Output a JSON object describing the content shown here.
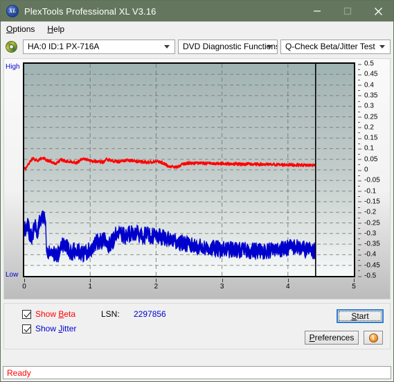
{
  "window": {
    "title": "PlexTools Professional XL V3.16",
    "icon": "app-xl-icon",
    "icon_text": "XL",
    "minimize": "minimize-icon",
    "maximize": "maximize-icon",
    "close": "close-icon",
    "titlebar_color": "#64775e"
  },
  "menubar": {
    "items": [
      {
        "label_pre": "",
        "accel": "O",
        "label_post": "ptions"
      },
      {
        "label_pre": "",
        "accel": "H",
        "label_post": "elp"
      }
    ]
  },
  "toolbar": {
    "drive_icon": "disc-icon",
    "drive": "HA:0 ID:1  PX-716A",
    "function": "DVD Diagnostic Functions",
    "test": "Q-Check Beta/Jitter Test"
  },
  "chart_labels": {
    "high": "High",
    "low": "Low"
  },
  "controls": {
    "show_beta": {
      "label_pre": "Show ",
      "accel": "B",
      "label_post": "eta",
      "checked": true,
      "color": "#ff0000"
    },
    "show_jitter": {
      "label_pre": "Show ",
      "accel": "J",
      "label_post": "itter",
      "checked": true,
      "color": "#0000cc"
    },
    "lsn_label": "LSN:",
    "lsn_value": "2297856",
    "start": {
      "label_pre": "",
      "accel": "S",
      "label_post": "tart"
    },
    "preferences": {
      "label_pre": "",
      "accel": "P",
      "label_post": "references"
    },
    "info": {
      "icon": "info-icon",
      "glyph": "i"
    }
  },
  "statusbar": {
    "text": "Ready",
    "color": "#ff0000"
  },
  "chart_data": {
    "type": "line",
    "title": "Q-Check Beta/Jitter Test",
    "xlabel": "",
    "ylabel": "",
    "xlim": [
      0,
      5
    ],
    "ylim": [
      -0.5,
      0.5
    ],
    "grid": true,
    "legend": "checkbox-toggles",
    "x_ticks": [
      0,
      1,
      2,
      3,
      4,
      5
    ],
    "x_tick_labels": [
      "0",
      "1",
      "2",
      "3",
      "4",
      "5"
    ],
    "y_ticks": [
      0.5,
      0.45,
      0.4,
      0.35,
      0.3,
      0.25,
      0.2,
      0.15,
      0.1,
      0.05,
      0,
      -0.05,
      -0.1,
      -0.15,
      -0.2,
      -0.25,
      -0.3,
      -0.35,
      -0.4,
      -0.45,
      -0.5
    ],
    "y_tick_labels": [
      "0.5",
      "0.45",
      "0.4",
      "0.35",
      "0.3",
      "0.25",
      "0.2",
      "0.15",
      "0.1",
      "0.05",
      "0",
      "-0.05",
      "-0.1",
      "-0.15",
      "-0.2",
      "-0.25",
      "-0.3",
      "-0.35",
      "-0.4",
      "-0.45",
      "-0.5"
    ],
    "gridlines_major_x": [
      1,
      2,
      3,
      4
    ],
    "data_end_x": 4.42,
    "axis_label_top": "High",
    "axis_label_bottom": "Low",
    "series": [
      {
        "name": "Beta",
        "color": "#ff0000",
        "x": [
          0.02,
          0.05,
          0.08,
          0.11,
          0.14,
          0.17,
          0.2,
          0.24,
          0.28,
          0.32,
          0.36,
          0.4,
          0.44,
          0.48,
          0.52,
          0.56,
          0.6,
          0.65,
          0.7,
          0.75,
          0.8,
          0.85,
          0.9,
          0.95,
          1.0,
          1.05,
          1.1,
          1.15,
          1.2,
          1.25,
          1.3,
          1.35,
          1.4,
          1.45,
          1.5,
          1.55,
          1.6,
          1.65,
          1.7,
          1.8,
          1.9,
          2.0,
          2.1,
          2.2,
          2.3,
          2.4,
          2.5,
          2.6,
          2.7,
          2.8,
          2.9,
          3.0,
          3.1,
          3.2,
          3.3,
          3.4,
          3.5,
          3.6,
          3.7,
          3.8,
          3.9,
          4.0,
          4.1,
          4.2,
          4.3,
          4.42
        ],
        "y": [
          0.005,
          0.02,
          0.036,
          0.048,
          0.055,
          0.048,
          0.04,
          0.05,
          0.056,
          0.05,
          0.044,
          0.04,
          0.034,
          0.029,
          0.04,
          0.048,
          0.044,
          0.041,
          0.038,
          0.036,
          0.034,
          0.046,
          0.056,
          0.05,
          0.043,
          0.041,
          0.04,
          0.038,
          0.036,
          0.05,
          0.046,
          0.042,
          0.04,
          0.038,
          0.042,
          0.046,
          0.044,
          0.042,
          0.04,
          0.038,
          0.036,
          0.04,
          0.034,
          0.016,
          0.012,
          0.026,
          0.032,
          0.031,
          0.031,
          0.03,
          0.03,
          0.029,
          0.029,
          0.028,
          0.027,
          0.027,
          0.026,
          0.026,
          0.025,
          0.025,
          0.024,
          0.024,
          0.023,
          0.023,
          0.022,
          0.022
        ]
      },
      {
        "name": "Jitter",
        "color": "#0000cc",
        "x": [
          0.02,
          0.05,
          0.08,
          0.11,
          0.14,
          0.17,
          0.2,
          0.23,
          0.26,
          0.29,
          0.32,
          0.34,
          0.36,
          0.4,
          0.45,
          0.5,
          0.55,
          0.6,
          0.65,
          0.7,
          0.75,
          0.8,
          0.85,
          0.9,
          0.95,
          1.0,
          1.05,
          1.1,
          1.15,
          1.2,
          1.25,
          1.3,
          1.35,
          1.4,
          1.45,
          1.5,
          1.55,
          1.6,
          1.65,
          1.7,
          1.75,
          1.8,
          1.9,
          2.0,
          2.1,
          2.2,
          2.3,
          2.4,
          2.5,
          2.6,
          2.7,
          2.8,
          2.9,
          3.0,
          3.2,
          3.4,
          3.6,
          3.8,
          4.0,
          4.1,
          4.2,
          4.3,
          4.42
        ],
        "y": [
          -0.275,
          -0.255,
          -0.3,
          -0.32,
          -0.29,
          -0.265,
          -0.3,
          -0.25,
          -0.235,
          -0.23,
          -0.238,
          -0.39,
          -0.4,
          -0.385,
          -0.395,
          -0.405,
          -0.375,
          -0.345,
          -0.365,
          -0.39,
          -0.385,
          -0.37,
          -0.39,
          -0.395,
          -0.385,
          -0.375,
          -0.36,
          -0.34,
          -0.335,
          -0.33,
          -0.345,
          -0.355,
          -0.33,
          -0.3,
          -0.305,
          -0.31,
          -0.315,
          -0.3,
          -0.295,
          -0.3,
          -0.305,
          -0.308,
          -0.31,
          -0.315,
          -0.32,
          -0.33,
          -0.335,
          -0.345,
          -0.355,
          -0.36,
          -0.365,
          -0.37,
          -0.372,
          -0.375,
          -0.378,
          -0.38,
          -0.382,
          -0.378,
          -0.368,
          -0.362,
          -0.37,
          -0.378,
          -0.382
        ]
      }
    ],
    "noise_amplitude": {
      "Beta": 0.006,
      "Jitter": 0.03
    }
  }
}
